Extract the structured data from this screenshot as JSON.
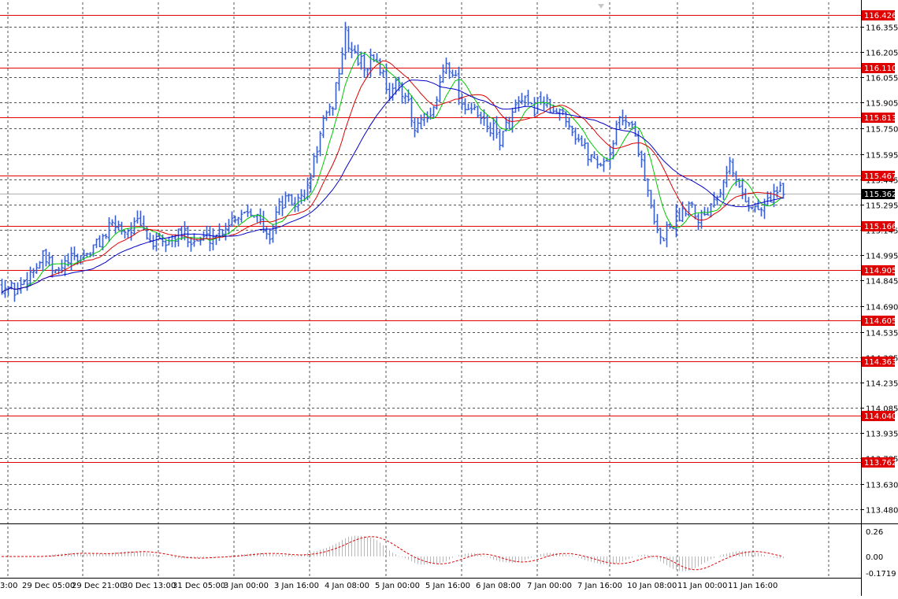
{
  "chart_data": {
    "type": "candlestick",
    "main": {
      "ylim": [
        113.4,
        116.5
      ],
      "price_ticks": [
        116.355,
        116.205,
        116.055,
        115.905,
        115.75,
        115.595,
        115.445,
        115.295,
        115.145,
        114.995,
        114.845,
        114.69,
        114.535,
        114.385,
        114.235,
        114.085,
        113.935,
        113.785,
        113.63,
        113.48
      ],
      "price_tick_labels": [
        "116.355",
        "116.205",
        "116.055",
        "115.905",
        "115.750",
        "115.595",
        "115.445",
        "115.295",
        "115.145",
        "114.995",
        "114.845",
        "114.690",
        "114.535",
        "114.385",
        "114.235",
        "114.085",
        "113.935",
        "113.785",
        "113.630",
        "113.480"
      ],
      "levels": [
        {
          "value": 116.426,
          "label": "116.426"
        },
        {
          "value": 116.11,
          "label": "116.110"
        },
        {
          "value": 115.813,
          "label": "115.813"
        },
        {
          "value": 115.467,
          "label": "115.467"
        },
        {
          "value": 115.166,
          "label": "115.166"
        },
        {
          "value": 114.905,
          "label": "114.905"
        },
        {
          "value": 114.605,
          "label": "114.605"
        },
        {
          "value": 114.363,
          "label": "114.363"
        },
        {
          "value": 114.04,
          "label": "114.040"
        },
        {
          "value": 113.762,
          "label": "113.762"
        }
      ],
      "current_price": {
        "value": 115.362,
        "label": "115.362"
      },
      "price_path": [
        [
          0,
          114.82
        ],
        [
          20,
          114.78
        ],
        [
          40,
          114.9
        ],
        [
          55,
          114.98
        ],
        [
          70,
          114.88
        ],
        [
          85,
          114.95
        ],
        [
          100,
          114.98
        ],
        [
          115,
          115.02
        ],
        [
          130,
          115.1
        ],
        [
          145,
          115.18
        ],
        [
          160,
          115.14
        ],
        [
          175,
          115.18
        ],
        [
          190,
          115.08
        ],
        [
          205,
          115.05
        ],
        [
          220,
          115.1
        ],
        [
          235,
          115.12
        ],
        [
          250,
          115.08
        ],
        [
          265,
          115.1
        ],
        [
          280,
          115.14
        ],
        [
          295,
          115.22
        ],
        [
          310,
          115.26
        ],
        [
          320,
          115.28
        ],
        [
          330,
          115.18
        ],
        [
          340,
          115.08
        ],
        [
          350,
          115.25
        ],
        [
          360,
          115.32
        ],
        [
          375,
          115.3
        ],
        [
          390,
          115.38
        ],
        [
          400,
          115.6
        ],
        [
          410,
          115.78
        ],
        [
          420,
          115.85
        ],
        [
          430,
          116.1
        ],
        [
          438,
          116.3
        ],
        [
          445,
          116.22
        ],
        [
          455,
          116.15
        ],
        [
          465,
          116.12
        ],
        [
          475,
          116.18
        ],
        [
          485,
          116.08
        ],
        [
          495,
          115.95
        ],
        [
          505,
          116.02
        ],
        [
          515,
          115.95
        ],
        [
          525,
          115.72
        ],
        [
          535,
          115.8
        ],
        [
          545,
          115.78
        ],
        [
          555,
          115.95
        ],
        [
          565,
          116.15
        ],
        [
          575,
          116.1
        ],
        [
          585,
          115.9
        ],
        [
          595,
          115.88
        ],
        [
          605,
          115.82
        ],
        [
          615,
          115.78
        ],
        [
          625,
          115.74
        ],
        [
          635,
          115.68
        ],
        [
          645,
          115.78
        ],
        [
          655,
          115.88
        ],
        [
          665,
          115.9
        ],
        [
          675,
          115.85
        ],
        [
          685,
          115.93
        ],
        [
          695,
          115.88
        ],
        [
          705,
          115.82
        ],
        [
          715,
          115.86
        ],
        [
          725,
          115.75
        ],
        [
          735,
          115.68
        ],
        [
          745,
          115.6
        ],
        [
          755,
          115.56
        ],
        [
          765,
          115.54
        ],
        [
          775,
          115.62
        ],
        [
          785,
          115.8
        ],
        [
          795,
          115.82
        ],
        [
          805,
          115.72
        ],
        [
          815,
          115.55
        ],
        [
          822,
          115.35
        ],
        [
          830,
          115.18
        ],
        [
          838,
          115.08
        ],
        [
          846,
          115.15
        ],
        [
          856,
          115.2
        ],
        [
          866,
          115.26
        ],
        [
          876,
          115.32
        ],
        [
          886,
          115.22
        ],
        [
          896,
          115.25
        ],
        [
          906,
          115.35
        ],
        [
          916,
          115.42
        ],
        [
          924,
          115.56
        ],
        [
          932,
          115.45
        ],
        [
          940,
          115.38
        ],
        [
          950,
          115.3
        ],
        [
          960,
          115.26
        ],
        [
          970,
          115.28
        ],
        [
          978,
          115.35
        ],
        [
          988,
          115.37
        ],
        [
          996,
          115.36
        ]
      ],
      "ma_periods": [
        8,
        16,
        30
      ]
    },
    "time_axis": {
      "labels": [
        "3:00",
        "29 Dec 05:00",
        "29 Dec 21:00",
        "30 Dec 13:00",
        "31 Dec 05:00",
        "3 Jan 00:00",
        "3 Jan 16:00",
        "4 Jan 08:00",
        "5 Jan 00:00",
        "5 Jan 16:00",
        "6 Jan 08:00",
        "7 Jan 00:00",
        "7 Jan 16:00",
        "10 Jan 08:00",
        "11 Jan 00:00",
        "11 Jan 16:00"
      ]
    },
    "oscillator": {
      "ylim": [
        -0.22,
        0.3
      ],
      "tick_labels": [
        "0.26",
        "0.00",
        "-0.1719"
      ],
      "tick_values": [
        0.26,
        0.0,
        -0.1719
      ]
    },
    "colors": {
      "bars": "#3a5ec9",
      "ma_fast": "#00c800",
      "ma_mid": "#dc0000",
      "ma_slow": "#0000c8",
      "level_line": "#e00000",
      "level_label_bg": "#e00000",
      "level_label_text": "#ffffff",
      "grid": "#555555",
      "osc_signal": "#e00000",
      "osc_hist": "#b8b8b8"
    }
  }
}
